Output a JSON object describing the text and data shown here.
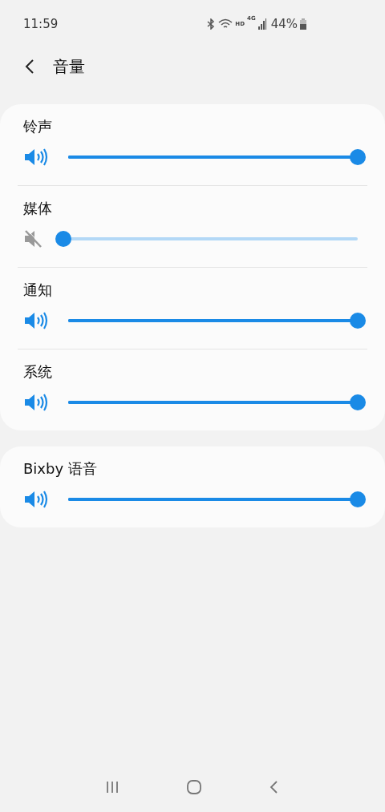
{
  "status_bar": {
    "time": "11:59",
    "network_hd": "HD",
    "network_type": "4G",
    "battery": "44%"
  },
  "header": {
    "title": "音量"
  },
  "groups": [
    {
      "sliders": [
        {
          "label": "铃声",
          "muted": false,
          "level": 1
        },
        {
          "label": "媒体",
          "muted": true,
          "level": 0
        },
        {
          "label": "通知",
          "muted": false,
          "level": 1
        },
        {
          "label": "系统",
          "muted": false,
          "level": 1
        }
      ]
    },
    {
      "sliders": [
        {
          "label": "Bixby 语音",
          "muted": false,
          "level": 1
        }
      ]
    }
  ]
}
